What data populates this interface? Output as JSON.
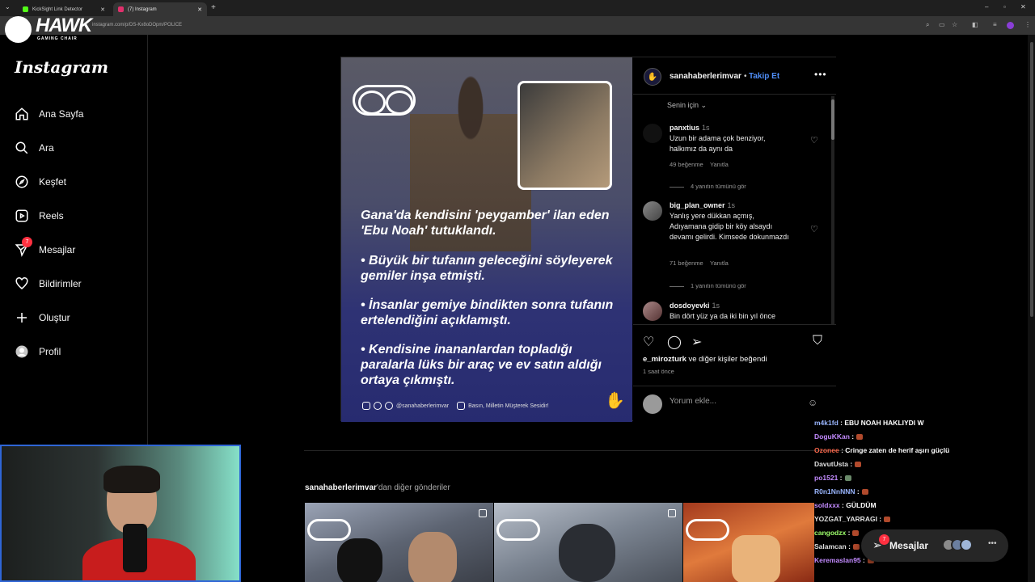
{
  "browser": {
    "tabs": [
      {
        "label": "KickSight Link Detector",
        "fav_color": "#53fc18"
      },
      {
        "label": "(7) Instagram",
        "fav_color": "#e1306c"
      }
    ],
    "url": "instagram.com/p/DS-Kx8oDOpm/POLICE"
  },
  "overlay": {
    "brand_name": "HAWK",
    "brand_sub": "GAMING CHAIR"
  },
  "sidebar": {
    "logo": "Instagram",
    "items": [
      {
        "label": "Ana Sayfa",
        "icon": "home-icon"
      },
      {
        "label": "Ara",
        "icon": "search-icon"
      },
      {
        "label": "Keşfet",
        "icon": "compass-icon"
      },
      {
        "label": "Reels",
        "icon": "reels-icon"
      },
      {
        "label": "Mesajlar",
        "icon": "send-icon",
        "badge": "7"
      },
      {
        "label": "Bildirimler",
        "icon": "heart-icon"
      },
      {
        "label": "Oluştur",
        "icon": "plus-icon"
      },
      {
        "label": "Profil",
        "icon": "avatar-icon"
      }
    ]
  },
  "post": {
    "image": {
      "headline": "Gana'da kendisini 'peygamber' ilan eden 'Ebu Noah' tutuklandı.",
      "bullets": [
        "• Büyük bir tufanın geleceğini söyleyerek gemiler inşa etmişti.",
        "• İnsanlar gemiye bindikten sonra tufanın ertelendiğini açıklamıştı.",
        "• Kendisine inananlardan topladığı paralarla lüks bir araç ve ev satın aldığı ortaya çıkmıştı."
      ],
      "footer_handle": "@sanahaberlerimvar",
      "footer_slogan": "Basın, Milletin Müşterek Sesidir!"
    },
    "author": "sanahaberlerimvar",
    "separator": "•",
    "follow": "Takip Et",
    "sort_label": "Senin için",
    "comments": [
      {
        "user": "panxtius",
        "time": "1s",
        "text": "Uzun bir adama çok benziyor, halkımız da aynı da",
        "likes": "49 beğenme",
        "reply": "Yanıtla",
        "view_replies": "4 yanıtın tümünü gör"
      },
      {
        "user": "big_plan_owner",
        "time": "1s",
        "text": "Yanlış yere dükkan açmış, Adıyamana gidip bir köy alsaydı devamı gelirdi. Kimsede dokunmazdı",
        "likes": "71 beğenme",
        "reply": "Yanıtla",
        "view_replies": "1 yanıtın tümünü gör"
      },
      {
        "user": "dosdoyevki",
        "time": "1s",
        "text": "Bin dört yüz ya da iki bin yıl önce"
      }
    ],
    "liked_by_user": "e_mirozturk",
    "liked_by_rest": " ve diğer kişiler beğendi",
    "liked_by_others": "diğer kişiler",
    "time_ago": "1 saat önce",
    "comment_placeholder": "Yorum ekle..."
  },
  "more_posts": {
    "user": "sanahaberlerimvar",
    "suffix": "'dan diğer gönderiler"
  },
  "chat": [
    {
      "user": "m4k1fd",
      "text": "EBU NOAH HAKLIYDI W",
      "color": "#9ab6ff"
    },
    {
      "user": "DoguKKan",
      "text": "",
      "color": "#c38bff",
      "emote": true
    },
    {
      "user": "Ozonee",
      "text": "Cringe zaten de herif aşırı güçlü",
      "color": "#ff6a4d"
    },
    {
      "user": "DavutUsta",
      "text": "",
      "color": "#e0e0e0",
      "emote": true
    },
    {
      "user": "po1521",
      "text": "",
      "color": "#c38bff",
      "emote": true
    },
    {
      "user": "R0n1NnNNN",
      "text": "",
      "color": "#9ab6ff",
      "emote": true
    },
    {
      "user": "soldxxx",
      "text": "GÜLDÜM",
      "color": "#c38bff"
    },
    {
      "user": "YOZGAT_YARRAGI",
      "text": "",
      "color": "#e0e0e0",
      "emote": true
    },
    {
      "user": "cangodzx",
      "text": "",
      "color": "#9dff6b",
      "emote": true
    },
    {
      "user": "Salamcan",
      "text": "",
      "color": "#e0e0e0",
      "emote": true
    },
    {
      "user": "Keremaslan95",
      "text": "",
      "color": "#c38bff",
      "emote": true
    }
  ],
  "messages_pill": {
    "label": "Mesajlar",
    "badge": "7"
  }
}
